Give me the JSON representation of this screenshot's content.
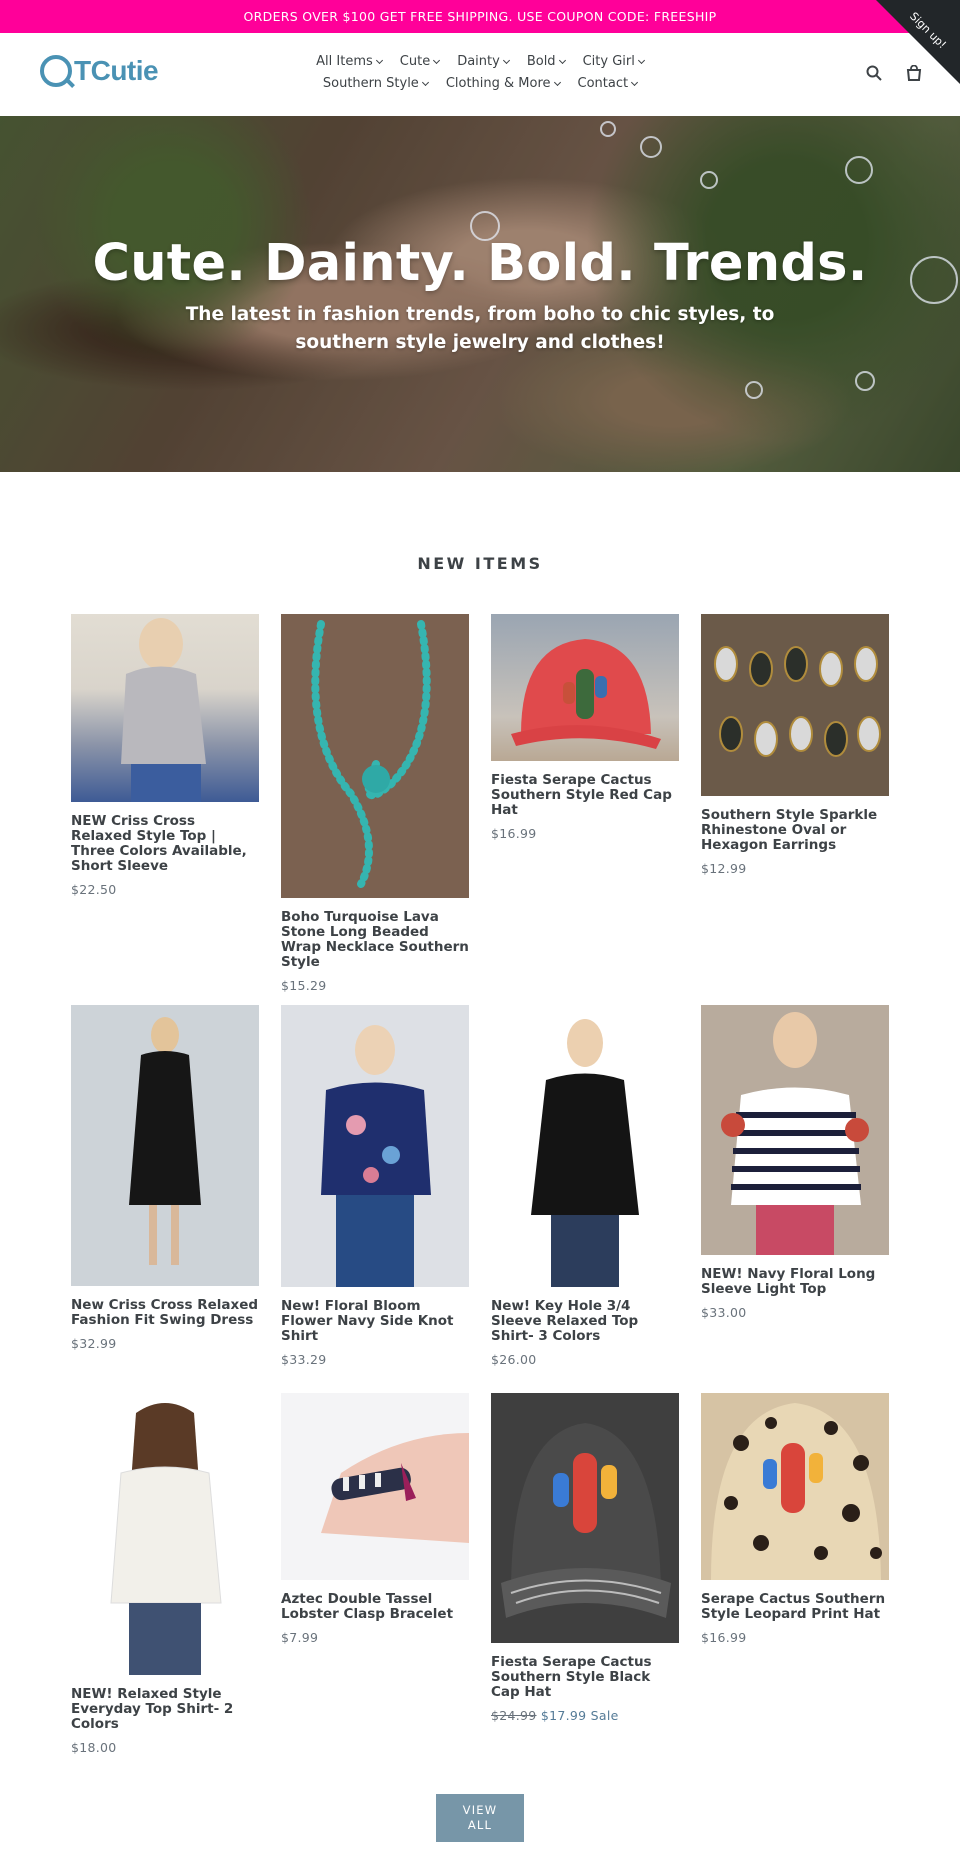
{
  "announcement": "ORDERS OVER $100 GET FREE SHIPPING. USE COUPON CODE: FREESHIP",
  "signup_ribbon": "Sign up!",
  "logo": "TCutie",
  "nav": {
    "row1": [
      "All Items",
      "Cute",
      "Dainty",
      "Bold",
      "City Girl"
    ],
    "row2": [
      "Southern Style",
      "Clothing & More",
      "Contact"
    ]
  },
  "icons": [
    "search-icon",
    "cart-icon"
  ],
  "hero": {
    "title": "Cute. Dainty. Bold. Trends.",
    "subtitle_line1": "The latest in fashion trends, from boho to chic styles, to",
    "subtitle_line2": "southern style jewelry and clothes!"
  },
  "section_title": "NEW ITEMS",
  "products": [
    {
      "title": "NEW Criss Cross Relaxed Style Top | Three Colors Available, Short Sleeve",
      "price": "$22.50"
    },
    {
      "title": "Boho Turquoise Lava Stone Long Beaded Wrap Necklace Southern Style",
      "price": "$15.29"
    },
    {
      "title": "Fiesta Serape Cactus Southern Style Red Cap Hat",
      "price": "$16.99"
    },
    {
      "title": "Southern Style Sparkle Rhinestone Oval or Hexagon Earrings",
      "price": "$12.99"
    },
    {
      "title": "New Criss Cross Relaxed Fashion Fit Swing Dress",
      "price": "$32.99"
    },
    {
      "title": "New! Floral Bloom Flower Navy Side Knot Shirt",
      "price": "$33.29"
    },
    {
      "title": "New! Key Hole 3/4 Sleeve Relaxed Top Shirt- 3 Colors",
      "price": "$26.00"
    },
    {
      "title": "NEW! Navy Floral Long Sleeve Light Top",
      "price": "$33.00"
    },
    {
      "title": "NEW! Relaxed Style Everyday Top Shirt- 2 Colors",
      "price": "$18.00"
    },
    {
      "title": "Aztec Double Tassel Lobster Clasp Bracelet",
      "price": "$7.99"
    },
    {
      "title": "Fiesta Serape Cactus Southern Style Black Cap Hat",
      "price_original": "$24.99",
      "price_sale": "$17.99",
      "sale_label": "Sale"
    },
    {
      "title": "Serape Cactus Southern Style Leopard Print Hat",
      "price": "$16.99"
    }
  ],
  "view_all": {
    "line1": "VIEW",
    "line2": "ALL"
  },
  "colors": {
    "announcement_bg": "#ff0099",
    "brand": "#4a92b4",
    "button": "#7796a8",
    "text": "#3d4246"
  }
}
